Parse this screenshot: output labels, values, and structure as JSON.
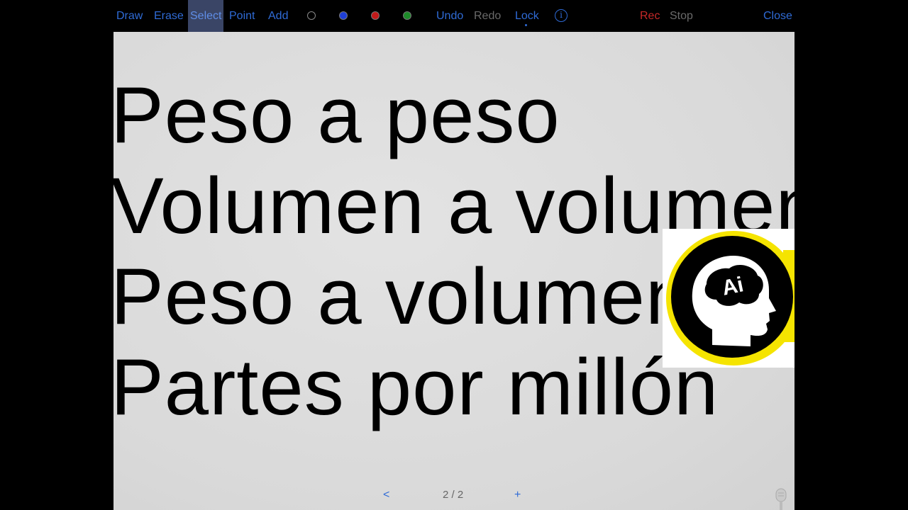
{
  "toolbar": {
    "draw": "Draw",
    "erase": "Erase",
    "select": "Select",
    "point": "Point",
    "add": "Add",
    "colors": [
      "#000000",
      "#1f3fd6",
      "#c21a1a",
      "#1e8a2a"
    ],
    "undo": "Undo",
    "redo": "Redo",
    "lock": "Lock",
    "info_icon": "info-icon",
    "rec": "Rec",
    "stop": "Stop",
    "close": "Close"
  },
  "slide": {
    "lines": [
      "Peso a peso",
      "Volumen a volumen",
      "Peso a volumen",
      "Partes por millón"
    ],
    "logo_text": "Ai",
    "logo_colors": {
      "ring": "#f5e400",
      "disc": "#000000",
      "head": "#ffffff"
    }
  },
  "navigation": {
    "prev": "<",
    "page": "2 / 2",
    "add": "+"
  }
}
